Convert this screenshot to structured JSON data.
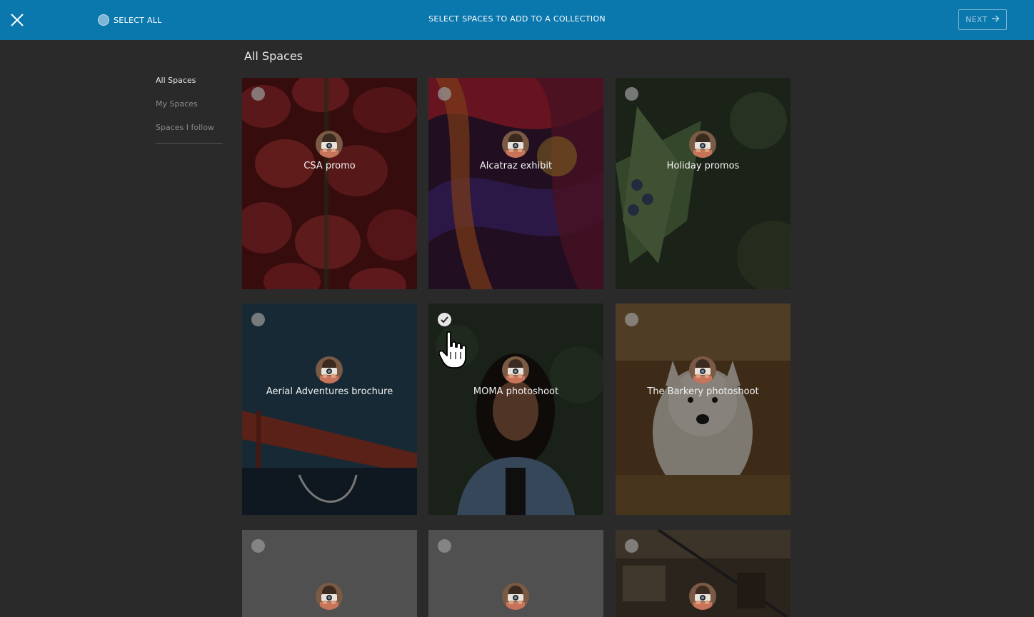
{
  "header": {
    "select_all_label": "SELECT ALL",
    "title": "SELECT SPACES TO ADD TO A COLLECTION",
    "next_label": "NEXT",
    "background_color": "#0a77ad"
  },
  "page": {
    "heading": "All Spaces"
  },
  "sidebar": {
    "items": [
      {
        "label": "All Spaces",
        "active": true
      },
      {
        "label": "My Spaces",
        "active": false
      },
      {
        "label": "Spaces I follow",
        "active": false
      }
    ]
  },
  "cards": [
    {
      "title": "CSA promo",
      "selected": false,
      "theme": "strawberries"
    },
    {
      "title": "Alcatraz exhibit",
      "selected": false,
      "theme": "colorful-mural"
    },
    {
      "title": "Holiday promos",
      "selected": false,
      "theme": "juniper-branch"
    },
    {
      "title": "Aerial Adventures brochure",
      "selected": false,
      "theme": "bridge-over-water"
    },
    {
      "title": "MOMA photoshoot",
      "selected": true,
      "theme": "portrait-woman"
    },
    {
      "title": "The Barkery photoshoot",
      "selected": false,
      "theme": "white-dog"
    },
    {
      "title": "",
      "selected": false,
      "theme": "plain-gray"
    },
    {
      "title": "",
      "selected": false,
      "theme": "plain-gray"
    },
    {
      "title": "",
      "selected": false,
      "theme": "cafe-interior"
    }
  ],
  "icons": {
    "close": "close-icon",
    "next_arrow": "arrow-right-icon",
    "checkmark": "checkmark-icon",
    "cursor": "pointer-hand-icon"
  }
}
